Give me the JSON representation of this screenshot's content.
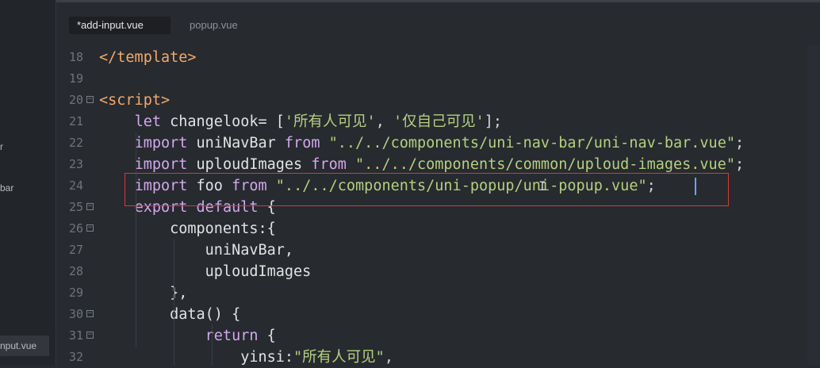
{
  "sidebar": {
    "labels": [
      "r",
      "bar",
      "nput.vue"
    ]
  },
  "tabs": [
    {
      "label": "*add-input.vue",
      "active": true
    },
    {
      "label": "popup.vue",
      "active": false
    }
  ],
  "editor": {
    "lines": [
      {
        "num": "18",
        "fold": false,
        "tokens": [
          [
            "tag",
            "</"
          ],
          [
            "tag",
            "template"
          ],
          [
            "tag",
            ">"
          ]
        ]
      },
      {
        "num": "19",
        "fold": false,
        "tokens": []
      },
      {
        "num": "20",
        "fold": true,
        "tokens": [
          [
            "tag",
            "<"
          ],
          [
            "tag",
            "script"
          ],
          [
            "tag",
            ">"
          ]
        ]
      },
      {
        "num": "21",
        "fold": false,
        "tokens": [
          [
            "plain",
            "    "
          ],
          [
            "kw",
            "let"
          ],
          [
            "plain",
            " changelook= ["
          ],
          [
            "str",
            "'所有人可见'"
          ],
          [
            "punc",
            ", "
          ],
          [
            "str",
            "'仅自己可见'"
          ],
          [
            "punc",
            "];"
          ]
        ]
      },
      {
        "num": "22",
        "fold": false,
        "tokens": [
          [
            "plain",
            "    "
          ],
          [
            "kw",
            "import"
          ],
          [
            "plain",
            " uniNavBar "
          ],
          [
            "kw",
            "from"
          ],
          [
            "plain",
            " "
          ],
          [
            "str",
            "\"../../components/uni-nav-bar/uni-nav-bar.vue\""
          ],
          [
            "punc",
            ";"
          ]
        ]
      },
      {
        "num": "23",
        "fold": false,
        "tokens": [
          [
            "plain",
            "    "
          ],
          [
            "kw",
            "import"
          ],
          [
            "plain",
            " uploudImages "
          ],
          [
            "kw",
            "from"
          ],
          [
            "plain",
            " "
          ],
          [
            "str",
            "\"../../components/common/uploud-images.vue\""
          ],
          [
            "punc",
            ";"
          ]
        ]
      },
      {
        "num": "24",
        "fold": false,
        "tokens": [
          [
            "plain",
            "    "
          ],
          [
            "kw",
            "import"
          ],
          [
            "plain",
            " foo "
          ],
          [
            "kw",
            "from"
          ],
          [
            "plain",
            " "
          ],
          [
            "str",
            "\"../../components/uni-popup/uni-popup.vue\""
          ],
          [
            "punc",
            ";"
          ]
        ]
      },
      {
        "num": "25",
        "fold": true,
        "tokens": [
          [
            "plain",
            "    "
          ],
          [
            "kw",
            "export"
          ],
          [
            "plain",
            " "
          ],
          [
            "kw",
            "default"
          ],
          [
            "plain",
            " {"
          ]
        ]
      },
      {
        "num": "26",
        "fold": true,
        "tokens": [
          [
            "plain",
            "        components:{"
          ]
        ]
      },
      {
        "num": "27",
        "fold": false,
        "tokens": [
          [
            "plain",
            "            uniNavBar,"
          ]
        ]
      },
      {
        "num": "28",
        "fold": false,
        "tokens": [
          [
            "plain",
            "            uploudImages"
          ]
        ]
      },
      {
        "num": "29",
        "fold": false,
        "tokens": [
          [
            "plain",
            "        },"
          ]
        ]
      },
      {
        "num": "30",
        "fold": true,
        "tokens": [
          [
            "plain",
            "        data() {"
          ]
        ]
      },
      {
        "num": "31",
        "fold": true,
        "tokens": [
          [
            "plain",
            "            "
          ],
          [
            "kw",
            "return"
          ],
          [
            "plain",
            " {"
          ]
        ]
      },
      {
        "num": "32",
        "fold": false,
        "tokens": [
          [
            "plain",
            "                yinsi:"
          ],
          [
            "str",
            "\"所有人可见\""
          ],
          [
            "punc",
            ","
          ]
        ]
      }
    ]
  }
}
